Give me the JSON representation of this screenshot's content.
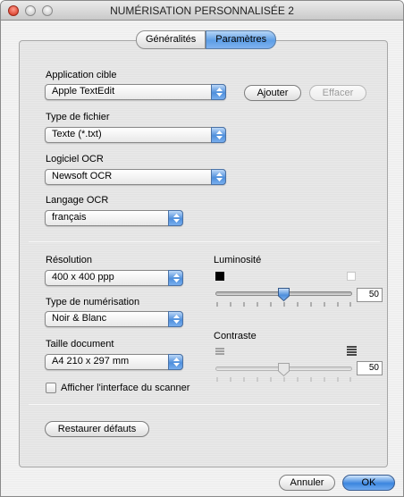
{
  "window": {
    "title": "NUMÉRISATION PERSONNALISÉE 2"
  },
  "tabs": [
    {
      "label": "Généralités",
      "selected": false
    },
    {
      "label": "Paramètres",
      "selected": true
    }
  ],
  "target_app": {
    "label": "Application cible",
    "value": "Apple TextEdit",
    "add_button": "Ajouter",
    "delete_button": "Effacer"
  },
  "file_type": {
    "label": "Type de fichier",
    "value": "Texte (*.txt)"
  },
  "ocr_software": {
    "label": "Logiciel OCR",
    "value": "Newsoft OCR"
  },
  "ocr_language": {
    "label": "Langage OCR",
    "value": "français"
  },
  "resolution": {
    "label": "Résolution",
    "value": "400 x 400 ppp"
  },
  "scan_type": {
    "label": "Type de numérisation",
    "value": "Noir & Blanc"
  },
  "document_size": {
    "label": "Taille document",
    "value": "A4  210 x 297 mm"
  },
  "show_scanner_interface": {
    "label": "Afficher l'interface du scanner",
    "checked": false
  },
  "brightness": {
    "label": "Luminosité",
    "value": "50",
    "enabled": true
  },
  "contrast": {
    "label": "Contraste",
    "value": "50",
    "enabled": false
  },
  "restore_button": "Restaurer défauts",
  "footer": {
    "cancel": "Annuler",
    "ok": "OK"
  },
  "colors": {
    "accent_blue": "#4f8fdc",
    "default_button": "#3c86df"
  }
}
